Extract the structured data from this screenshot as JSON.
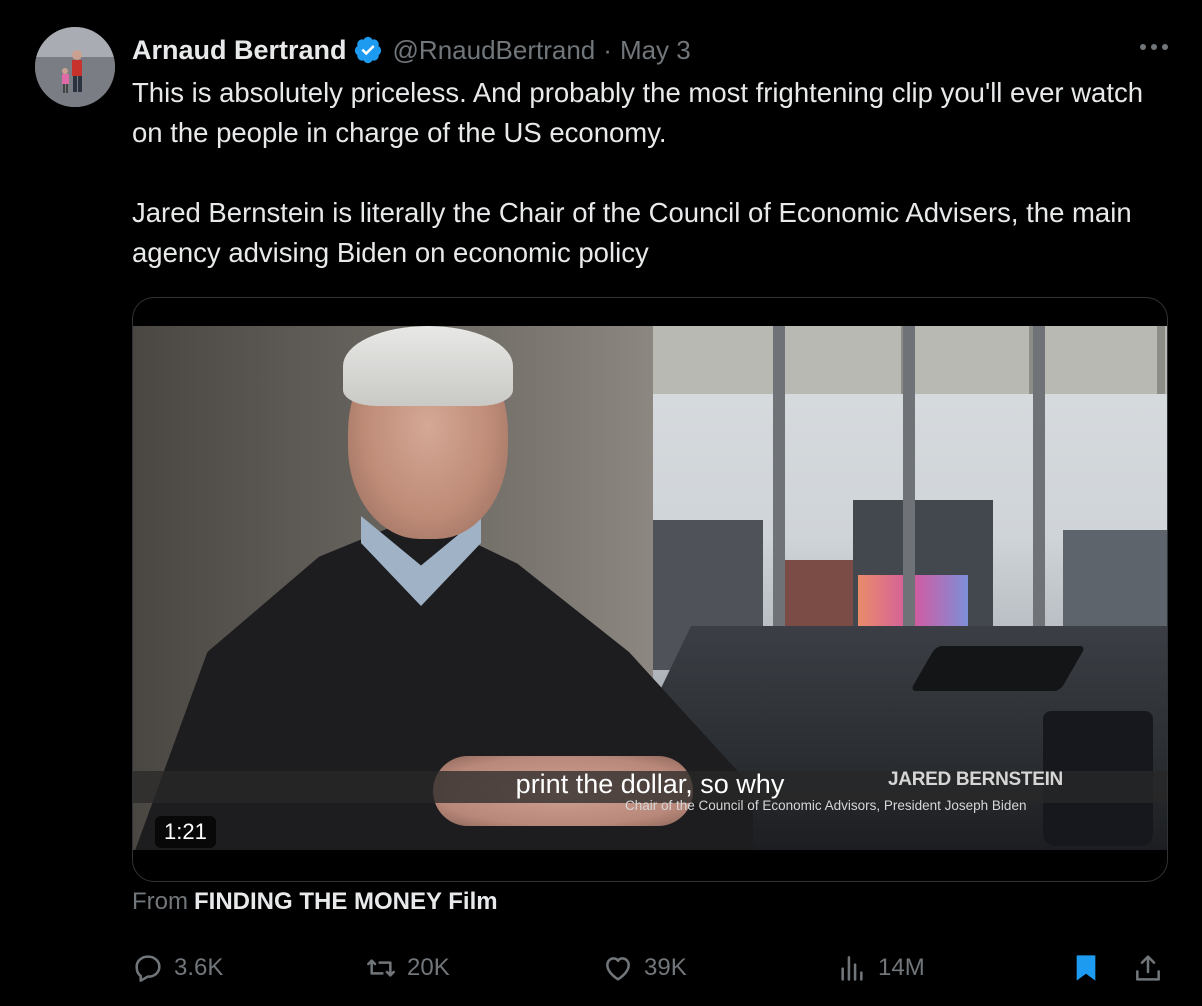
{
  "author": {
    "name": "Arnaud Bertrand",
    "handle": "@RnaudBertrand",
    "separator": "·",
    "date": "May 3"
  },
  "tweet": {
    "paragraph1": "This is absolutely priceless. And probably the most frightening clip you'll ever watch on the people in charge of the US economy.",
    "paragraph2": "Jared Bernstein is literally the Chair of the Council of Economic Advisers, the main agency advising Biden on economic policy"
  },
  "video": {
    "subtitle": "print the dollar, so why",
    "lower_third_name": "JARED BERNSTEIN",
    "lower_third_title": "Chair of the Council of Economic Advisors, President Joseph Biden",
    "duration": "1:21"
  },
  "source": {
    "prefix": "From",
    "name": "FINDING THE MONEY Film"
  },
  "stats": {
    "replies": "3.6K",
    "reposts": "20K",
    "likes": "39K",
    "views": "14M"
  },
  "colors": {
    "background": "#000000",
    "text": "#e7e9ea",
    "muted": "#71767b",
    "verified": "#1d9bf0",
    "bookmark": "#1d9bf0"
  }
}
